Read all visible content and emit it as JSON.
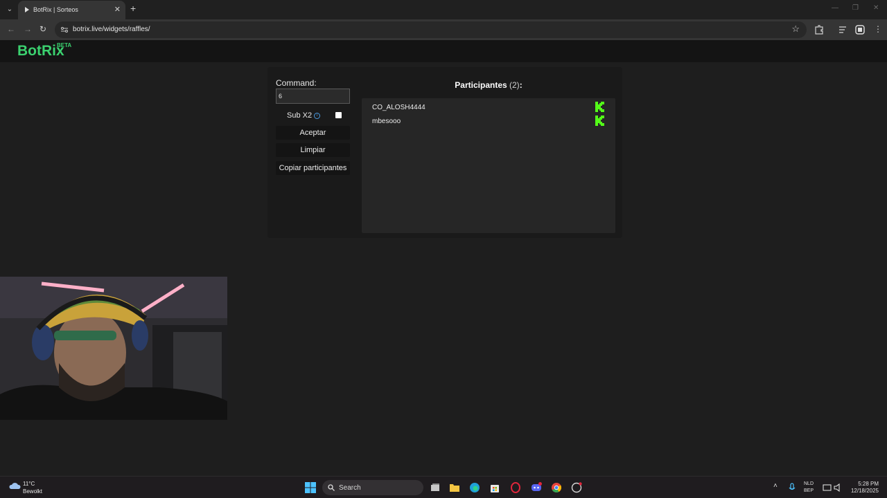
{
  "browser": {
    "tab_title": "BotRix | Sorteos",
    "url": "botrix.live/widgets/raffles/"
  },
  "site": {
    "logo": "BotRix",
    "beta": "BETA"
  },
  "raffle": {
    "command_label": "Command:",
    "command_value": "6",
    "sub_label": "Sub X2",
    "sub_checked": false,
    "accept_label": "Aceptar",
    "clear_label": "Limpiar",
    "copy_label": "Copiar participantes",
    "participants_title": "Participantes",
    "participants_count": "(2)",
    "participants_suffix": ":",
    "participants": [
      {
        "name": "CO_ALOSH4444",
        "platform_icon": "kick-icon"
      },
      {
        "name": "mbesooo",
        "platform_icon": "kick-icon"
      }
    ]
  },
  "taskbar": {
    "weather_temp": "11°C",
    "weather_desc": "Bewolkt",
    "search_label": "Search",
    "lang_1": "NLD",
    "lang_2": "BEP",
    "time": "5:28 PM",
    "date": "12/18/2025"
  },
  "colors": {
    "brand_green": "#3bd16f",
    "kick_green": "#53fc18"
  }
}
